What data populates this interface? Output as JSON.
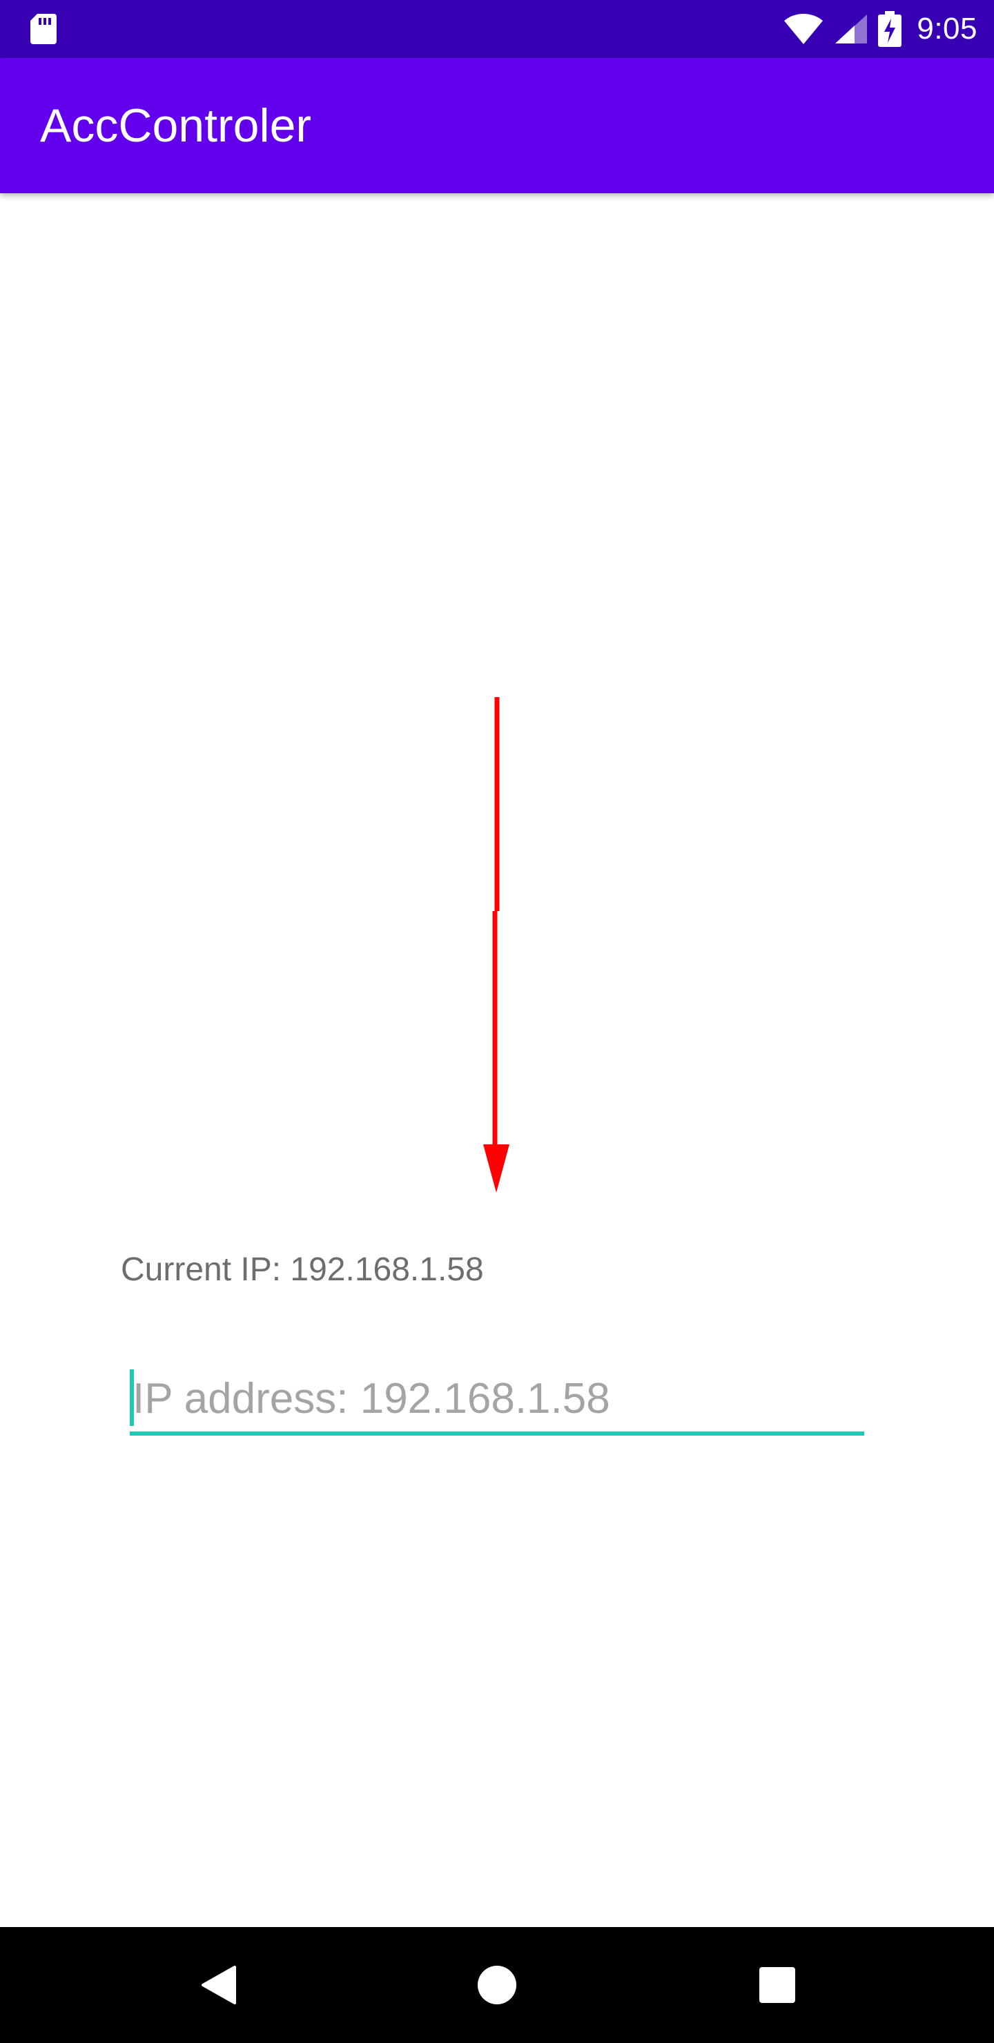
{
  "status_bar": {
    "time": "9:05",
    "icons": [
      "sd-card-icon",
      "wifi-icon",
      "signal-icon",
      "battery-charging-icon"
    ]
  },
  "app_bar": {
    "title": "AccControler"
  },
  "main": {
    "current_ip_label": "Current IP: 192.168.1.58",
    "ip_input": {
      "value": "",
      "placeholder": "IP address: 192.168.1.58"
    },
    "arrow_icon": "arrow-down-icon"
  },
  "nav_bar": {
    "icons": [
      "back-icon",
      "home-icon",
      "recents-icon"
    ]
  },
  "colors": {
    "status_bar": "#3700b3",
    "app_bar": "#6200ee",
    "accent": "#1fc8b8",
    "arrow": "#ff0000"
  }
}
